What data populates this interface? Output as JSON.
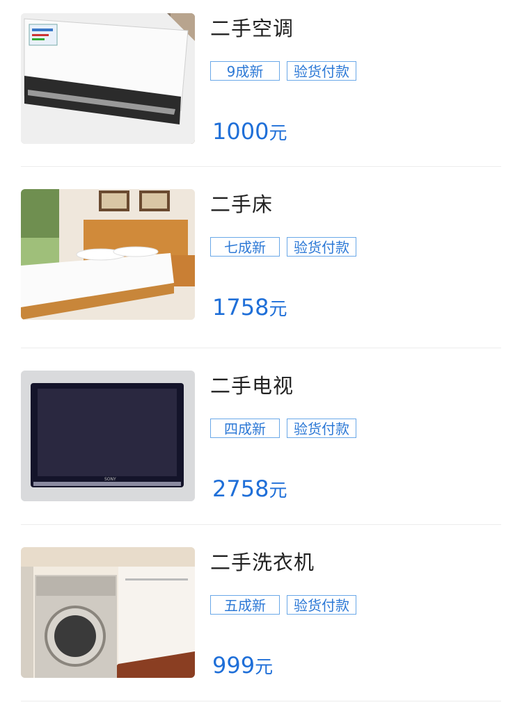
{
  "items": [
    {
      "title": "二手空调",
      "condition": "9成新",
      "payment": "验货付款",
      "price": "1000",
      "unit": "元",
      "image": "air-conditioner"
    },
    {
      "title": "二手床",
      "condition": "七成新",
      "payment": "验货付款",
      "price": "1758",
      "unit": "元",
      "image": "bed"
    },
    {
      "title": "二手电视",
      "condition": "四成新",
      "payment": "验货付款",
      "price": "2758",
      "unit": "元",
      "image": "television"
    },
    {
      "title": "二手洗衣机",
      "condition": "五成新",
      "payment": "验货付款",
      "price": "999",
      "unit": "元",
      "image": "washing-machine"
    }
  ]
}
